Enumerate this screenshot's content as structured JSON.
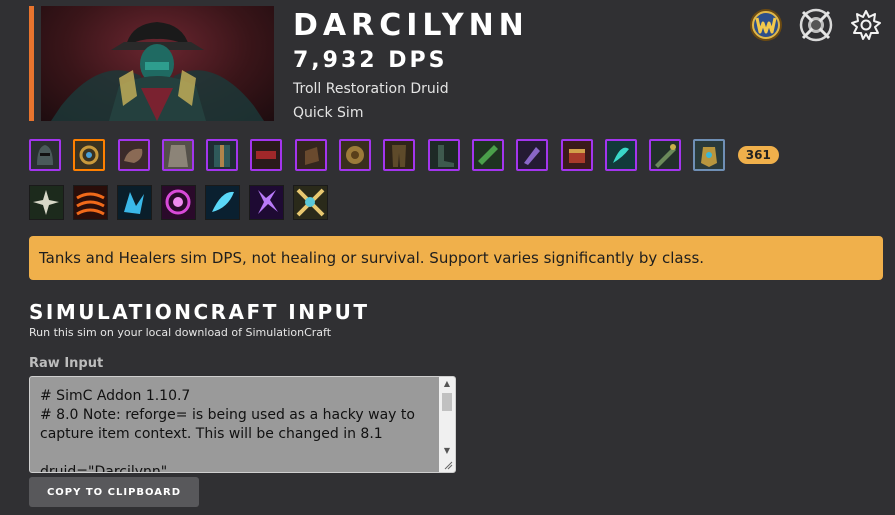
{
  "character": {
    "name": "DARCILYNN",
    "dps": "7,932 DPS",
    "spec": "Troll Restoration Druid",
    "sim_type": "Quick Sim"
  },
  "header_icons": [
    "wow-logo-icon",
    "faction-crest-icon",
    "gear-cog-icon"
  ],
  "gear": {
    "items": [
      {
        "name": "head-icon",
        "quality": "epic"
      },
      {
        "name": "neck-icon",
        "quality": "legendary"
      },
      {
        "name": "shoulder-icon",
        "quality": "epic"
      },
      {
        "name": "back-icon",
        "quality": "epic"
      },
      {
        "name": "chest-icon",
        "quality": "epic"
      },
      {
        "name": "wrist-icon",
        "quality": "epic"
      },
      {
        "name": "hands-icon",
        "quality": "epic"
      },
      {
        "name": "waist-icon",
        "quality": "epic"
      },
      {
        "name": "legs-icon",
        "quality": "epic"
      },
      {
        "name": "feet-icon",
        "quality": "epic"
      },
      {
        "name": "ring-1-icon",
        "quality": "epic"
      },
      {
        "name": "ring-2-icon",
        "quality": "epic"
      },
      {
        "name": "trinket-1-icon",
        "quality": "epic"
      },
      {
        "name": "trinket-2-icon",
        "quality": "epic"
      },
      {
        "name": "main-hand-icon",
        "quality": "epic"
      },
      {
        "name": "off-hand-icon",
        "quality": "artifact"
      }
    ],
    "item_level": "361"
  },
  "talents": [
    "talent-1-icon",
    "talent-2-icon",
    "talent-3-icon",
    "talent-4-icon",
    "talent-5-icon",
    "talent-6-icon",
    "talent-7-icon"
  ],
  "warning": "Tanks and Healers sim DPS, not healing or survival. Support varies significantly by class.",
  "simc": {
    "title": "SIMULATIONCRAFT INPUT",
    "subtitle": "Run this sim on your local download of SimulationCraft",
    "raw_label": "Raw Input",
    "raw_text": "# SimC Addon 1.10.7\n# 8.0 Note: reforge= is being used as a hacky way to capture item context. This will be changed in 8.1\n\ndruid=\"Darcilynn\"",
    "copy_label": "COPY TO CLIPBOARD"
  },
  "colors": {
    "accent": "#e8742e",
    "warning_bg": "#f0b04b",
    "epic_border": "#a335ee",
    "legendary_border": "#ff8000",
    "page_bg": "#303033"
  }
}
